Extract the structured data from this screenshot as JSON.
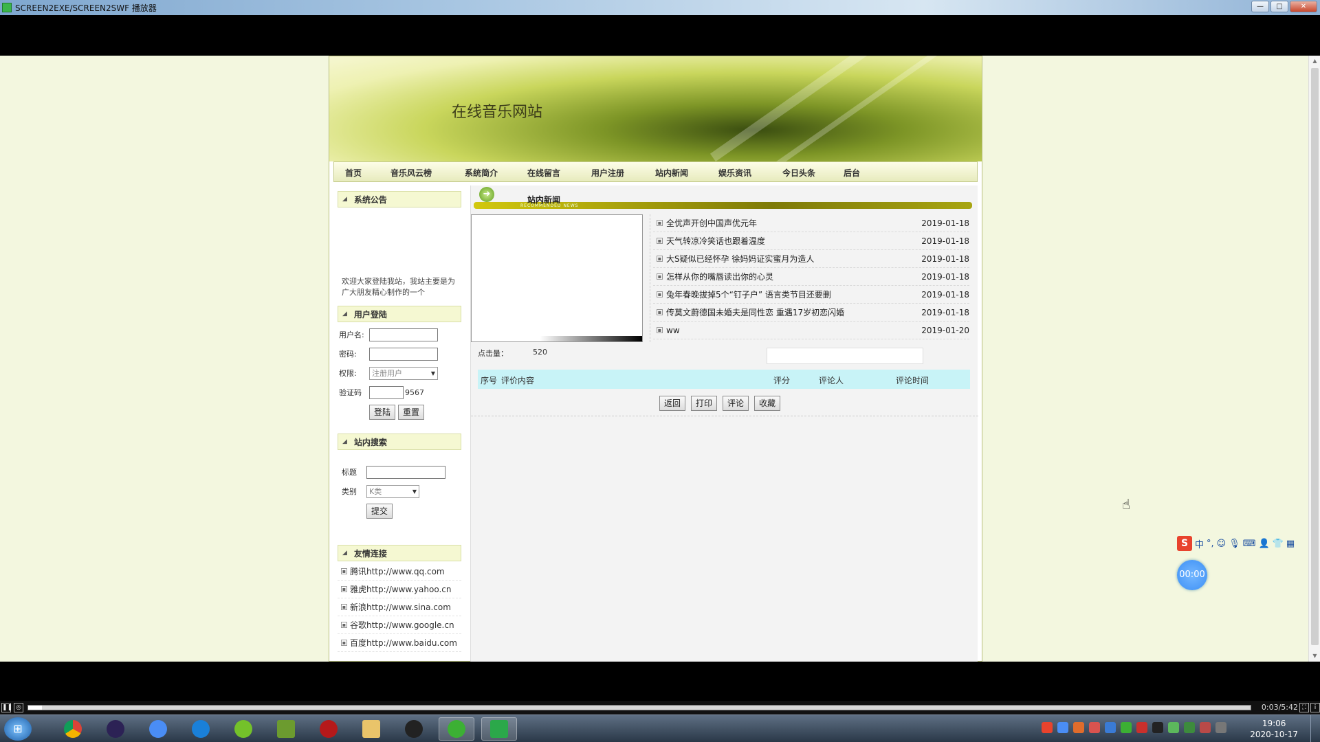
{
  "window": {
    "title": "SCREEN2EXE/SCREEN2SWF 播放器",
    "buttons": [
      "—",
      "□",
      "✕"
    ]
  },
  "site": {
    "title": "在线音乐网站",
    "nav": [
      "首页",
      "音乐风云榜",
      "系统简介",
      "在线留言",
      "用户注册",
      "站内新闻",
      "娱乐资讯",
      "今日头条",
      "后台"
    ]
  },
  "sidebar": {
    "notice_title": "系统公告",
    "notice_text": "欢迎大家登陆我站，我站主要是为广大朋友精心制作的一个",
    "login_title": "用户登陆",
    "username_label": "用户名:",
    "password_label": "密码:",
    "role_label": "权限:",
    "role_value": "注册用户",
    "captcha_label": "验证码",
    "captcha_code": "9567",
    "login_button": "登陆",
    "reset_button": "重置",
    "search_title": "站内搜索",
    "search_title_label": "标题",
    "search_category_label": "类别",
    "search_category_value": "K类",
    "submit_button": "提交",
    "links_title": "友情连接",
    "links": [
      "腾讯http://www.qq.com",
      "雅虎http://www.yahoo.cn",
      "新浪http://www.sina.com",
      "谷歌http://www.google.cn",
      "百度http://www.baidu.com"
    ]
  },
  "main": {
    "section_title": "站内新闻",
    "section_sub": "RECOMMENDED NEWS",
    "clicks_label": "点击量：",
    "clicks_value": "520",
    "news": [
      {
        "title": "全优声开创中国声优元年",
        "date": "2019-01-18"
      },
      {
        "title": "天气转凉冷笑话也跟着温度",
        "date": "2019-01-18"
      },
      {
        "title": "大S疑似已经怀孕 徐妈妈证实蜜月为造人",
        "date": "2019-01-18"
      },
      {
        "title": "怎样从你的嘴唇读出你的心灵",
        "date": "2019-01-18"
      },
      {
        "title": "兔年春晚拔掉5个“钉子户” 语言类节目还要删",
        "date": "2019-01-18"
      },
      {
        "title": "传莫文蔚德国未婚夫是同性恋 重遇17岁初恋闪婚",
        "date": "2019-01-18"
      },
      {
        "title": "ww",
        "date": "2019-01-20"
      }
    ],
    "table_headers": [
      "序号",
      "评价内容",
      "评分",
      "评论人",
      "评论时间"
    ],
    "actions": [
      "返回",
      "打印",
      "评论",
      "收藏"
    ]
  },
  "player": {
    "time": "0:03/5:42"
  },
  "taskbar": {
    "time": "19:06",
    "date": "2020-10-17"
  },
  "overlay": {
    "ime_mode": "中",
    "timer": "00:00"
  }
}
